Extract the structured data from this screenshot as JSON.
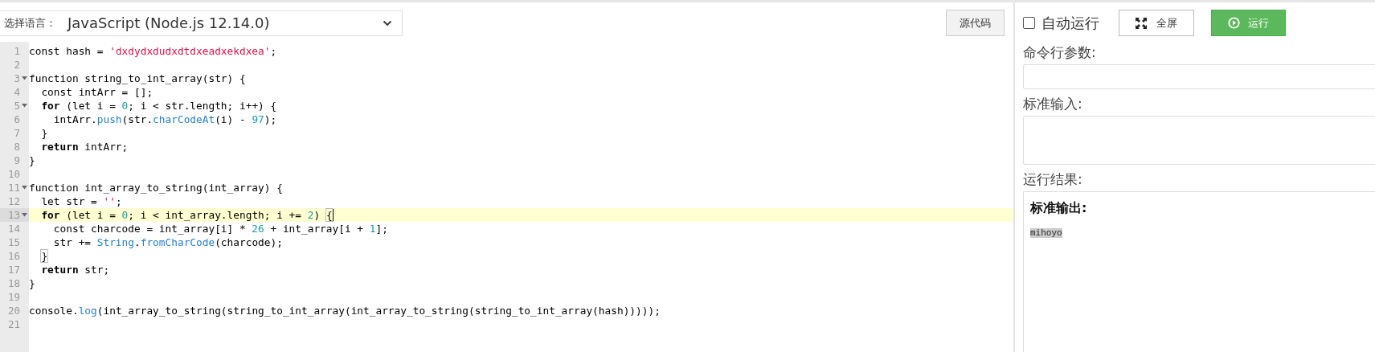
{
  "toolbar": {
    "language_label": "选择语言：",
    "language": "JavaScript (Node.js 12.14.0)",
    "source_button": "源代码"
  },
  "editor": {
    "lines": [
      {
        "number": "1",
        "foldable": false,
        "active": false,
        "tokens": [
          {
            "kind": "plain",
            "text": "const hash = "
          },
          {
            "kind": "string",
            "text": "'dxdydxdudxdtdxeadxekdxea'"
          },
          {
            "kind": "plain",
            "text": ";"
          }
        ]
      },
      {
        "number": "2",
        "foldable": false,
        "active": false
      },
      {
        "number": "3",
        "foldable": true,
        "active": false,
        "tokens": [
          {
            "kind": "plain",
            "text": "function string_to_int_array(str) {"
          }
        ]
      },
      {
        "number": "4",
        "foldable": false,
        "active": false,
        "tokens": [
          {
            "kind": "plain",
            "text": "  const intArr = [];"
          }
        ]
      },
      {
        "number": "5",
        "foldable": true,
        "active": false,
        "tokens": [
          {
            "kind": "keyword",
            "text": "  for"
          },
          {
            "kind": "plain",
            "text": " (let i = "
          },
          {
            "kind": "number",
            "text": "0"
          },
          {
            "kind": "plain",
            "text": "; i < str.length; i++) {"
          }
        ]
      },
      {
        "number": "6",
        "foldable": false,
        "active": false,
        "tokens": [
          {
            "kind": "plain",
            "text": "    intArr."
          },
          {
            "kind": "builtin",
            "text": "push"
          },
          {
            "kind": "plain",
            "text": "(str."
          },
          {
            "kind": "builtin",
            "text": "charCodeAt"
          },
          {
            "kind": "plain",
            "text": "(i) - "
          },
          {
            "kind": "number",
            "text": "97"
          },
          {
            "kind": "plain",
            "text": ");"
          }
        ]
      },
      {
        "number": "7",
        "foldable": false,
        "active": false,
        "tokens": [
          {
            "kind": "plain",
            "text": "  }"
          }
        ]
      },
      {
        "number": "8",
        "foldable": false,
        "active": false,
        "tokens": [
          {
            "kind": "keyword",
            "text": "  return"
          },
          {
            "kind": "plain",
            "text": " intArr;"
          }
        ]
      },
      {
        "number": "9",
        "foldable": false,
        "active": false,
        "tokens": [
          {
            "kind": "plain",
            "text": "}"
          }
        ]
      },
      {
        "number": "10",
        "foldable": false,
        "active": false
      },
      {
        "number": "11",
        "foldable": true,
        "active": false,
        "tokens": [
          {
            "kind": "plain",
            "text": "function int_array_to_string(int_array) {"
          }
        ]
      },
      {
        "number": "12",
        "foldable": false,
        "active": false,
        "tokens": [
          {
            "kind": "plain",
            "text": "  let str = "
          },
          {
            "kind": "string",
            "text": "''"
          },
          {
            "kind": "plain",
            "text": ";"
          }
        ]
      },
      {
        "number": "13",
        "foldable": true,
        "active": true,
        "cursor": true,
        "tokens": [
          {
            "kind": "keyword",
            "text": "  for"
          },
          {
            "kind": "plain",
            "text": " (let i = "
          },
          {
            "kind": "number",
            "text": "0"
          },
          {
            "kind": "plain",
            "text": "; i < int_array.length; i += "
          },
          {
            "kind": "number",
            "text": "2"
          },
          {
            "kind": "plain",
            "text": ") "
          },
          {
            "kind": "bracket",
            "text": "{"
          }
        ]
      },
      {
        "number": "14",
        "foldable": false,
        "active": false,
        "tokens": [
          {
            "kind": "plain",
            "text": "    const charcode = int_array[i] * "
          },
          {
            "kind": "number",
            "text": "26"
          },
          {
            "kind": "plain",
            "text": " + int_array[i + "
          },
          {
            "kind": "number",
            "text": "1"
          },
          {
            "kind": "plain",
            "text": "];"
          }
        ]
      },
      {
        "number": "15",
        "foldable": false,
        "active": false,
        "tokens": [
          {
            "kind": "plain",
            "text": "    str += "
          },
          {
            "kind": "builtin",
            "text": "String"
          },
          {
            "kind": "plain",
            "text": "."
          },
          {
            "kind": "builtin",
            "text": "fromCharCode"
          },
          {
            "kind": "plain",
            "text": "(charcode);"
          }
        ]
      },
      {
        "number": "16",
        "foldable": false,
        "active": false,
        "tokens": [
          {
            "kind": "bracket",
            "text": "  }"
          }
        ]
      },
      {
        "number": "17",
        "foldable": false,
        "active": false,
        "tokens": [
          {
            "kind": "keyword",
            "text": "  return"
          },
          {
            "kind": "plain",
            "text": " str;"
          }
        ]
      },
      {
        "number": "18",
        "foldable": false,
        "active": false,
        "tokens": [
          {
            "kind": "plain",
            "text": "}"
          }
        ]
      },
      {
        "number": "19",
        "foldable": false,
        "active": false
      },
      {
        "number": "20",
        "foldable": false,
        "active": false,
        "tokens": [
          {
            "kind": "plain",
            "text": "console."
          },
          {
            "kind": "builtin",
            "text": "log"
          },
          {
            "kind": "plain",
            "text": "(int_array_to_string(string_to_int_array(int_array_to_string(string_to_int_array(hash)))));"
          }
        ]
      },
      {
        "number": "21",
        "foldable": false,
        "active": false
      }
    ]
  },
  "runner": {
    "auto_run": {
      "label": "自动运行",
      "checked": false
    },
    "fullscreen_button": "全屏",
    "run_button": "运行",
    "args_label": "命令行参数:",
    "stdin_label": "标准输入:",
    "result_label": "运行结果:",
    "output": {
      "heading": "标准输出:",
      "text": "mihoyo"
    }
  }
}
